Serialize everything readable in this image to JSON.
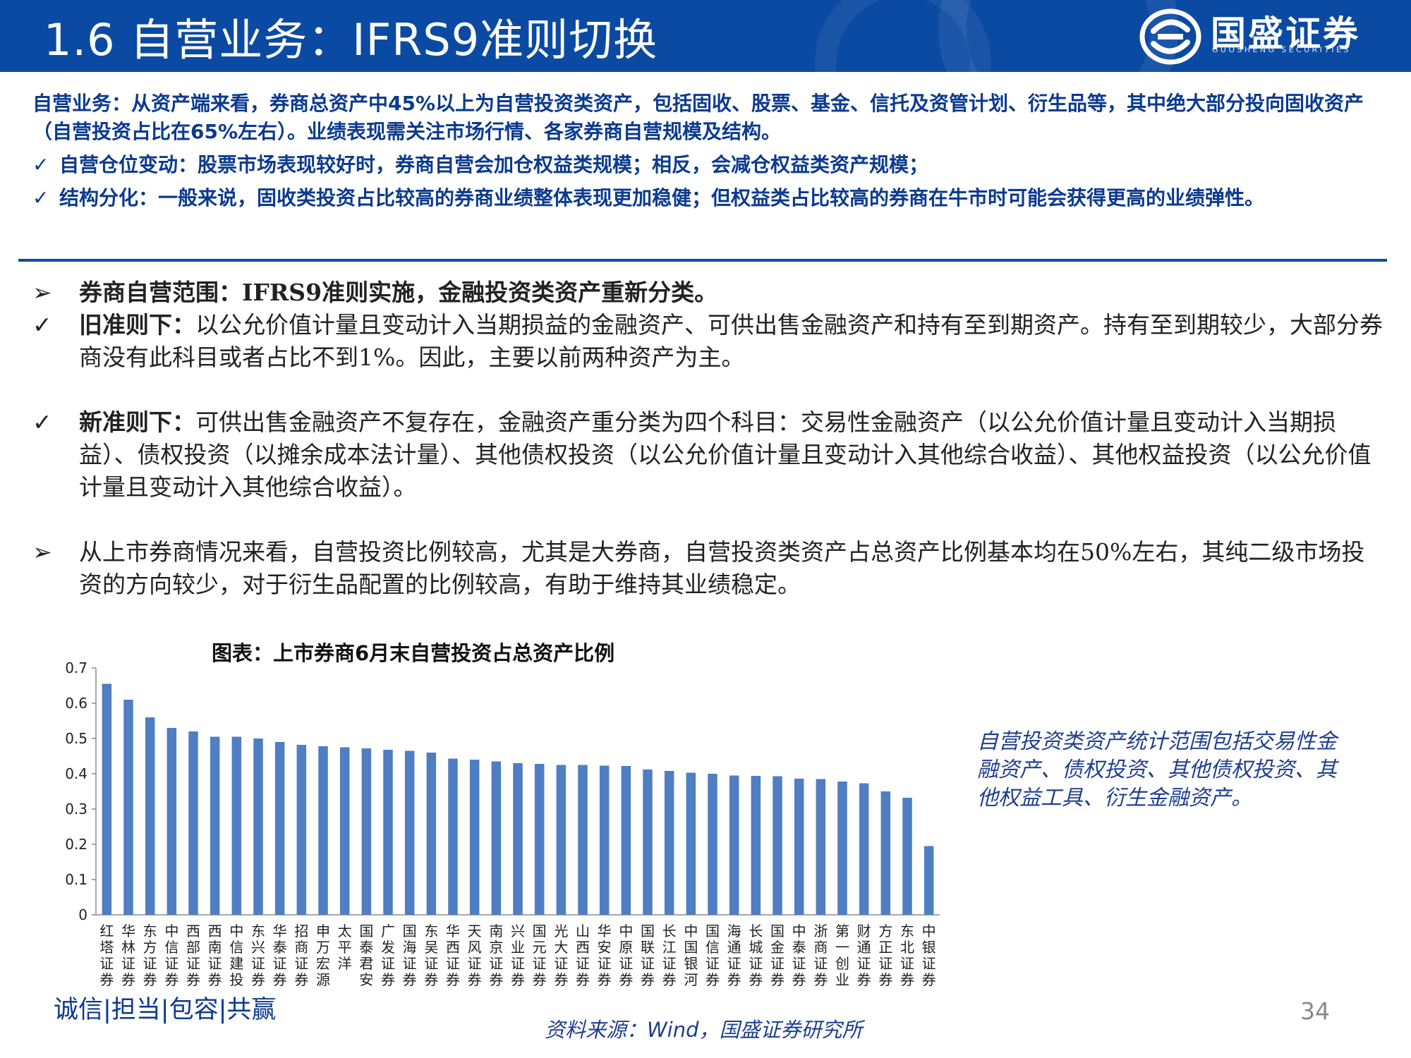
{
  "header": {
    "title": "1.6 自营业务：IFRS9准则切换",
    "logo_text": "国盛证券",
    "logo_sub": "GUOSHENG SECURITIES",
    "colors": {
      "bar": "#0b4aa2",
      "text": "#ffffff"
    }
  },
  "summary": {
    "intro": "自营业务：从资产端来看，券商总资产中45%以上为自营投资类资产，包括固收、股票、基金、信托及资管计划、衍生品等，其中绝大部分投向固收资产（自营投资占比在65%左右）。业绩表现需关注市场行情、各家券商自营规模及结构。",
    "items": [
      {
        "marker": "✓",
        "text": "自营仓位变动：股票市场表现较好时，券商自营会加仓权益类规模；相反，会减仓权益类资产规模；"
      },
      {
        "marker": "✓",
        "text": "结构分化：一般来说，固收类投资占比较高的券商业绩整体表现更加稳健；但权益类占比较高的券商在牛市时可能会获得更高的业绩弹性。"
      }
    ]
  },
  "body": {
    "p1": {
      "marker": "➢",
      "label": "券商自营范围：IFRS9准则实施，金融投资类资产重新分类。"
    },
    "p2": {
      "marker": "✓",
      "label": "旧准则下：",
      "text": "以公允价值计量且变动计入当期损益的金融资产、可供出售金融资产和持有至到期资产。持有至到期较少，大部分券商没有此科目或者占比不到1%。因此，主要以前两种资产为主。"
    },
    "p3": {
      "marker": "✓",
      "label": "新准则下：",
      "text": "可供出售金融资产不复存在，金融资产重分类为四个科目：交易性金融资产（以公允价值计量且变动计入当期损益）、债权投资（以摊余成本法计量）、其他债权投资（以公允价值计量且变动计入其他综合收益）、其他权益投资（以公允价值计量且变动计入其他综合收益）。"
    },
    "p4": {
      "marker": "➢",
      "text": "从上市券商情况来看，自营投资比例较高，尤其是大券商，自营投资类资产占总资产比例基本均在50%左右，其纯二级市场投资的方向较少，对于衍生品配置的比例较高，有助于维持其业绩稳定。"
    }
  },
  "chart_title": "图表：上市券商6月末自营投资占总资产比例",
  "chart_data": {
    "type": "bar",
    "title": "图表：上市券商6月末自营投资占总资产比例",
    "categories": [
      "红塔证券",
      "华林证券",
      "东方证券",
      "中信证券",
      "西部证券",
      "西南证券",
      "中信建投",
      "东兴证券",
      "华泰证券",
      "招商证券",
      "申万宏源",
      "太平洋",
      "国泰君安",
      "广发证券",
      "国海证券",
      "东吴证券",
      "华西证券",
      "天风证券",
      "南京证券",
      "兴业证券",
      "国元证券",
      "光大证券",
      "山西证券",
      "华安证券",
      "中原证券",
      "国联证券",
      "长江证券",
      "中国银河",
      "国信证券",
      "海通证券",
      "长城证券",
      "国金证券",
      "中泰证券",
      "浙商证券",
      "第一创业",
      "财通证券",
      "方正证券",
      "东北证券",
      "中银证券"
    ],
    "values": [
      0.655,
      0.61,
      0.56,
      0.53,
      0.52,
      0.505,
      0.505,
      0.5,
      0.49,
      0.482,
      0.478,
      0.475,
      0.472,
      0.468,
      0.465,
      0.46,
      0.443,
      0.44,
      0.435,
      0.43,
      0.428,
      0.425,
      0.425,
      0.423,
      0.422,
      0.412,
      0.408,
      0.403,
      0.4,
      0.395,
      0.394,
      0.393,
      0.386,
      0.385,
      0.378,
      0.373,
      0.35,
      0.332,
      0.195
    ],
    "xlabel": "",
    "ylabel": "",
    "ylim": [
      0,
      0.7
    ],
    "yticks": [
      "0",
      "0.1",
      "0.2",
      "0.3",
      "0.4",
      "0.5",
      "0.6",
      "0.7"
    ],
    "grid": false,
    "legend": "none",
    "bar_color": "#4f7ec2"
  },
  "note": "自营投资类资产统计范围包括交易性金融资产、债权投资、其他债权投资、其他权益工具、衍生金融资产。",
  "footer": {
    "slogan": "诚信|担当|包容|共赢",
    "source": "资料来源：Wind，国盛证券研究所",
    "page": "34"
  }
}
